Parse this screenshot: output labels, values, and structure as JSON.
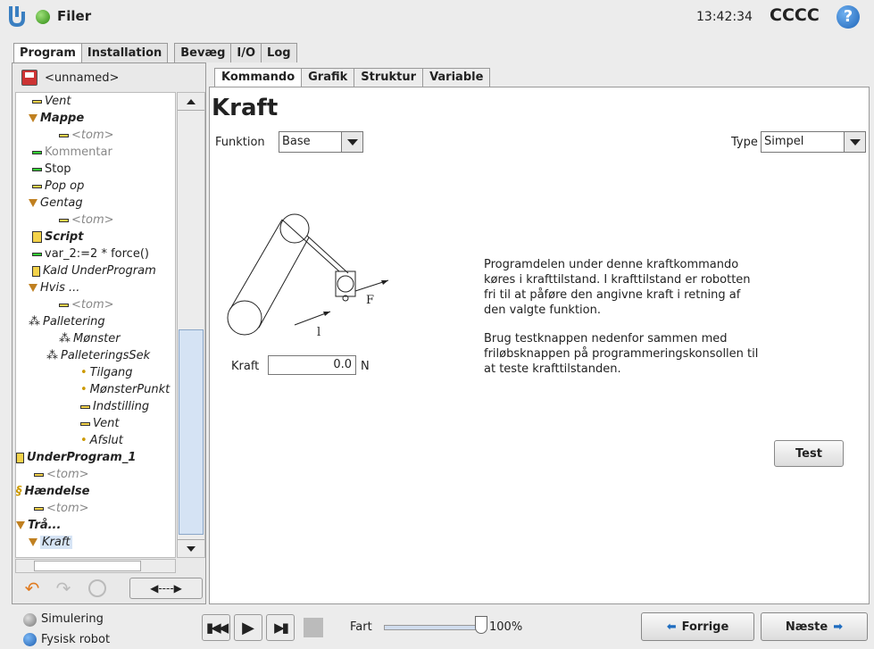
{
  "app": {
    "title": "Filer",
    "time": "13:42:34",
    "robot_name": "CCCC"
  },
  "top_tabs": [
    {
      "label": "Program"
    },
    {
      "label": "Installation"
    },
    {
      "label": "Bevæg"
    },
    {
      "label": "I/O"
    },
    {
      "label": "Log"
    }
  ],
  "program_name": "<unnamed>",
  "tree": [
    {
      "label": "Vent"
    },
    {
      "label": "Mappe"
    },
    {
      "label": "<tom>"
    },
    {
      "label": "Kommentar"
    },
    {
      "label": "Stop"
    },
    {
      "label": "Pop op"
    },
    {
      "label": "Gentag"
    },
    {
      "label": "<tom>"
    },
    {
      "label": "Script"
    },
    {
      "label": "var_2:=2 * force()"
    },
    {
      "label": "Kald UnderProgram"
    },
    {
      "label": "Hvis ..."
    },
    {
      "label": "<tom>"
    },
    {
      "label": "Palletering"
    },
    {
      "label": "Mønster"
    },
    {
      "label": "PalleteringsSek"
    },
    {
      "label": "Tilgang"
    },
    {
      "label": "MønsterPunkt"
    },
    {
      "label": "Indstilling"
    },
    {
      "label": "Vent"
    },
    {
      "label": "Afslut"
    },
    {
      "label": "UnderProgram_1"
    },
    {
      "label": "<tom>"
    },
    {
      "label": "Hændelse"
    },
    {
      "label": "<tom>"
    },
    {
      "label": "Trå..."
    },
    {
      "label": "Kraft"
    }
  ],
  "sub_tabs": [
    {
      "label": "Kommando"
    },
    {
      "label": "Grafik"
    },
    {
      "label": "Struktur"
    },
    {
      "label": "Variable"
    }
  ],
  "command": {
    "heading": "Kraft",
    "funktion_label": "Funktion",
    "funktion_value": "Base",
    "type_label": "Type",
    "type_value": "Simpel",
    "diagram_f_label": "F",
    "diagram_l_label": "l",
    "kraft_label": "Kraft",
    "kraft_value": "0.0",
    "kraft_unit": "N",
    "description1_lines": [
      "Programdelen under denne kraftkommando",
      "køres i krafttilstand. I krafttilstand er robotten",
      "fri til at påføre den angivne kraft i retning af",
      "den valgte funktion."
    ],
    "description2_lines": [
      "Brug testknappen nedenfor sammen med",
      "friløbsknappen på programmeringskonsollen til",
      "at teste krafttilstanden."
    ],
    "test_label": "Test"
  },
  "bottom": {
    "simulation_label": "Simulering",
    "real_robot_label": "Fysisk robot",
    "speed_label": "Fart",
    "speed_value": "100%",
    "speed_fraction": 1.0,
    "prev_label": "Forrige",
    "next_label": "Næste"
  },
  "colors": {
    "accent": "#1a7bd0",
    "tab_active_bg": "#ffffff",
    "brand_blue": "#2a6fb8"
  }
}
